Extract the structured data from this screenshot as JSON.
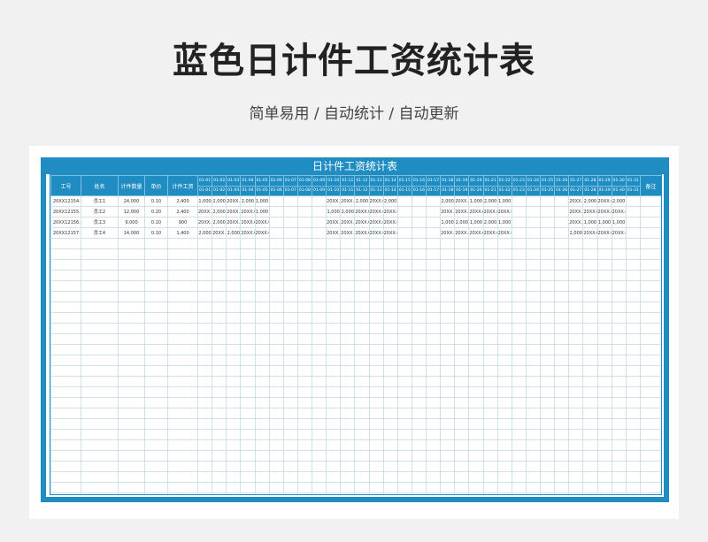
{
  "header": {
    "title": "蓝色日计件工资统计表",
    "subtitle": "简单易用 / 自动统计 / 自动更新"
  },
  "sheet": {
    "title": "日计件工资统计表",
    "columns": [
      "工号",
      "姓名",
      "计件数量",
      "单价",
      "计件工资"
    ],
    "remark_label": "备注",
    "day_headers": [
      "01-01",
      "01-02",
      "01-03",
      "01-04",
      "01-05",
      "01-06",
      "01-07",
      "01-08",
      "01-09",
      "01-10",
      "01-11",
      "01-12",
      "01-13",
      "01-14",
      "01-15",
      "01-16",
      "01-17",
      "01-18",
      "01-19",
      "01-20",
      "01-21",
      "01-22",
      "01-23",
      "01-24",
      "01-25",
      "01-26",
      "01-27",
      "01-28",
      "01-29",
      "01-30",
      "01-31"
    ],
    "rows": [
      {
        "id": "20XX12154.C",
        "name": "员工1",
        "qty": "24,000",
        "price": "0.10",
        "wage": "2,400",
        "days": [
          "1,000",
          "2,000",
          "20XX.C",
          "2,000",
          "1,000",
          "",
          "",
          "",
          "",
          "20XX.C",
          "20XX.C",
          "2,000",
          "20XX.C",
          "2,000",
          "",
          "",
          "",
          "2,000",
          "20XX.C",
          "1,000",
          "2,000",
          "1,000",
          "",
          "",
          "",
          "",
          "20XX.C",
          "2,000",
          "20XX.C",
          "2,000",
          "",
          "20XX.C"
        ]
      },
      {
        "id": "20XX12155.C",
        "name": "员工2",
        "qty": "12,000",
        "price": "0.20",
        "wage": "2,400",
        "days": [
          "20XX.C",
          "2,000",
          "20XX.C",
          "20XX.C",
          "1,000",
          "",
          "",
          "",
          "",
          "1,000",
          "2,000",
          "20XX.C",
          "20XX.C",
          "20XX.C",
          "",
          "",
          "",
          "20XX.C",
          "20XX.C",
          "20XX.C",
          "20XX.C",
          "20XX.0",
          "",
          "",
          "",
          "",
          "20XX.C",
          "20XX.C",
          "20XX.C",
          "20XX.0",
          "",
          "20XX.C"
        ]
      },
      {
        "id": "20XX12156.C",
        "name": "员工3",
        "qty": "9,000",
        "price": "0.10",
        "wage": "900",
        "days": [
          "20XX.C",
          "2,000",
          "20XX.C",
          "20XX.C",
          "20XX.0",
          "",
          "",
          "",
          "",
          "20XX.C",
          "20XX.C",
          "20XX.C",
          "20XX.C",
          "20XX.0",
          "",
          "",
          "",
          "1,000",
          "2,000",
          "1,000",
          "2,000",
          "1,000",
          "",
          "",
          "",
          "",
          "20XX.C",
          "1,000",
          "1,000",
          "1,000",
          "",
          "1,000"
        ]
      },
      {
        "id": "20XX12157.C",
        "name": "员工4",
        "qty": "14,000",
        "price": "0.10",
        "wage": "1,400",
        "days": [
          "2,000",
          "20XX.C",
          "2,000",
          "20XX.C",
          "20XX.0",
          "",
          "",
          "",
          "",
          "20XX.C",
          "20XX.C",
          "20XX.C",
          "20XX.C",
          "20XX.0",
          "",
          "",
          "",
          "20XX.C",
          "20XX.C",
          "20XX.C",
          "20XX.C",
          "20XX.0",
          "",
          "",
          "",
          "",
          "2,000",
          "20XX.C",
          "20XX.C",
          "20XX.0",
          "",
          "20XX.C"
        ]
      }
    ],
    "empty_rows": 26
  }
}
